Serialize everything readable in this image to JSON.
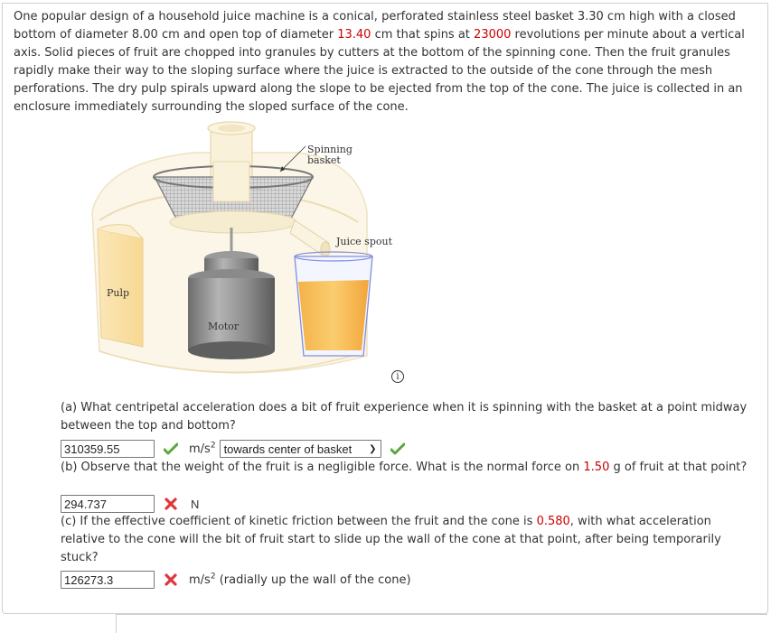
{
  "problem": {
    "intro_parts": [
      {
        "text": "One popular design of a household juice machine is a conical, perforated stainless steel basket 3.30 cm high with a closed bottom of diameter 8.00 cm and open top of diameter ",
        "highlight": false
      },
      {
        "text": "13.40",
        "highlight": true
      },
      {
        "text": " cm that spins at ",
        "highlight": false
      },
      {
        "text": "23000",
        "highlight": true
      },
      {
        "text": " revolutions per minute about a vertical axis. Solid pieces of fruit are chopped into granules by cutters at the bottom of the spinning cone. Then the fruit granules rapidly make their way to the sloping surface where the juice is extracted to the outside of the cone through the mesh perforations. The dry pulp spirals upward along the slope to be ejected from the top of the cone. The juice is collected in an enclosure immediately surrounding the sloped surface of the cone.",
        "highlight": false
      }
    ],
    "highlight_color": "#cc0000"
  },
  "figure": {
    "labels": {
      "spinning_basket_line1": "Spinning",
      "spinning_basket_line2": "basket",
      "juice_spout": "Juice spout",
      "pulp": "Pulp",
      "motor": "Motor"
    },
    "info_icon": "info-icon"
  },
  "parts": {
    "a": {
      "question": "(a) What centripetal acceleration does a bit of fruit experience when it is spinning with the basket at a point midway between the top and bottom?",
      "answer_value": "310359.55",
      "answer_status": "correct",
      "unit_base": "m/s",
      "unit_exp": "2",
      "direction_selected": "towards center of basket",
      "direction_status": "correct"
    },
    "b": {
      "question_parts": [
        {
          "text": "(b) Observe that the weight of the fruit is a negligible force. What is the normal force on ",
          "highlight": false
        },
        {
          "text": "1.50",
          "highlight": true
        },
        {
          "text": " g of fruit at that point?",
          "highlight": false
        }
      ],
      "answer_value": "294.737",
      "answer_status": "incorrect",
      "unit": "N"
    },
    "c": {
      "question_parts": [
        {
          "text": "(c) If the effective coefficient of kinetic friction between the fruit and the cone is ",
          "highlight": false
        },
        {
          "text": "0.580",
          "highlight": true
        },
        {
          "text": ", with what acceleration relative to the cone will the bit of fruit start to slide up the wall of the cone at that point, after being temporarily stuck?",
          "highlight": false
        }
      ],
      "answer_value": "126273.3",
      "answer_status": "incorrect",
      "unit_base": "m/s",
      "unit_exp": "2",
      "unit_suffix": " (radially up the wall of the cone)"
    }
  },
  "colors": {
    "correct": "#5aa83c",
    "incorrect": "#e0353b",
    "highlight": "#cc0000"
  }
}
